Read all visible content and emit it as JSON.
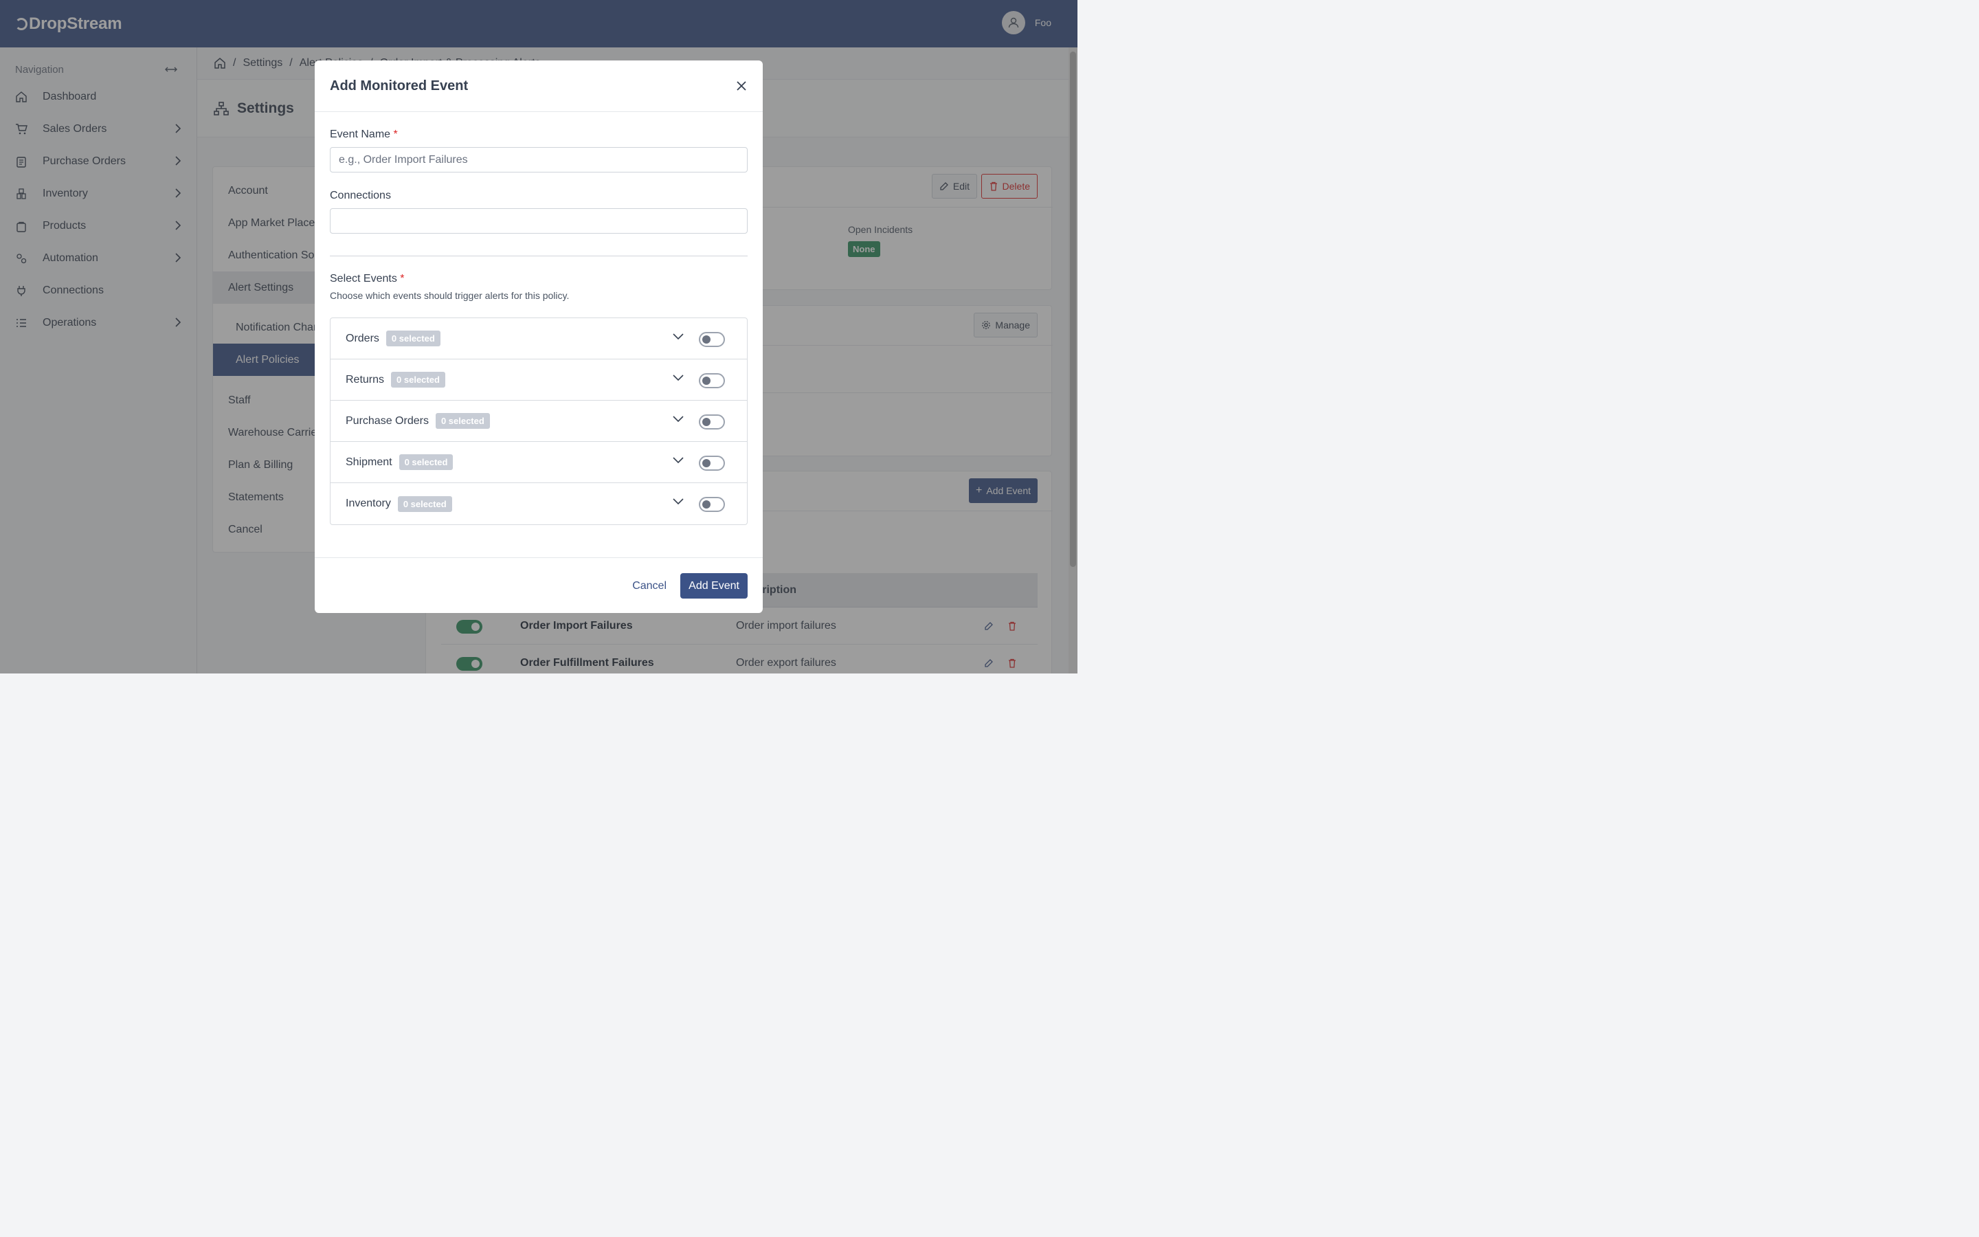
{
  "app": {
    "brand": "DropStream",
    "user_name": "Foo"
  },
  "sidebar": {
    "heading": "Navigation",
    "items": [
      {
        "label": "Dashboard",
        "icon": "home-icon",
        "has_submenu": false
      },
      {
        "label": "Sales Orders",
        "icon": "cart-icon",
        "has_submenu": true
      },
      {
        "label": "Purchase Orders",
        "icon": "clipboard-icon",
        "has_submenu": true
      },
      {
        "label": "Inventory",
        "icon": "boxes-icon",
        "has_submenu": true
      },
      {
        "label": "Products",
        "icon": "bag-icon",
        "has_submenu": true
      },
      {
        "label": "Automation",
        "icon": "gears-icon",
        "has_submenu": true
      },
      {
        "label": "Connections",
        "icon": "plug-icon",
        "has_submenu": false
      },
      {
        "label": "Operations",
        "icon": "list-icon",
        "has_submenu": true
      }
    ]
  },
  "breadcrumb": {
    "items": [
      "Settings",
      "Alert Policies",
      "Order Import & Processing Alerts"
    ]
  },
  "page": {
    "title": "Settings"
  },
  "settings_menu": {
    "items": [
      "Account",
      "App Market Places",
      "Authentication Sources",
      "Alert Settings"
    ],
    "sub_items": [
      "Notification Channels",
      "Alert Policies"
    ],
    "items_after": [
      "Staff",
      "Warehouse Carriers",
      "Plan & Billing",
      "Statements",
      "Cancel"
    ]
  },
  "policy_card": {
    "edit_label": "Edit",
    "delete_label": "Delete",
    "open_incidents_label": "Open Incidents",
    "open_incidents_value": "None"
  },
  "notify_card": {
    "manage_label": "Manage"
  },
  "events_card": {
    "add_event_label": "Add Event",
    "col_description": "Description",
    "rows": [
      {
        "name": "Order Import Failures",
        "description": "Order import failures",
        "enabled": true
      },
      {
        "name": "Order Fulfillment Failures",
        "description": "Order export failures",
        "enabled": true
      }
    ]
  },
  "modal": {
    "title": "Add Monitored Event",
    "event_name_label": "Event Name",
    "event_name_placeholder": "e.g., Order Import Failures",
    "event_name_value": "",
    "connections_label": "Connections",
    "connections_value": "",
    "select_events_label": "Select Events",
    "select_events_help": "Choose which events should trigger alerts for this policy.",
    "groups": [
      {
        "name": "Orders",
        "badge": "0 selected",
        "enabled": false
      },
      {
        "name": "Returns",
        "badge": "0 selected",
        "enabled": false
      },
      {
        "name": "Purchase Orders",
        "badge": "0 selected",
        "enabled": false
      },
      {
        "name": "Shipment",
        "badge": "0 selected",
        "enabled": false
      },
      {
        "name": "Inventory",
        "badge": "0 selected",
        "enabled": false
      }
    ],
    "cancel_label": "Cancel",
    "submit_label": "Add Event"
  },
  "colors": {
    "primary": "#3b5287",
    "success": "#2e8f5e",
    "danger": "#dc2626"
  }
}
